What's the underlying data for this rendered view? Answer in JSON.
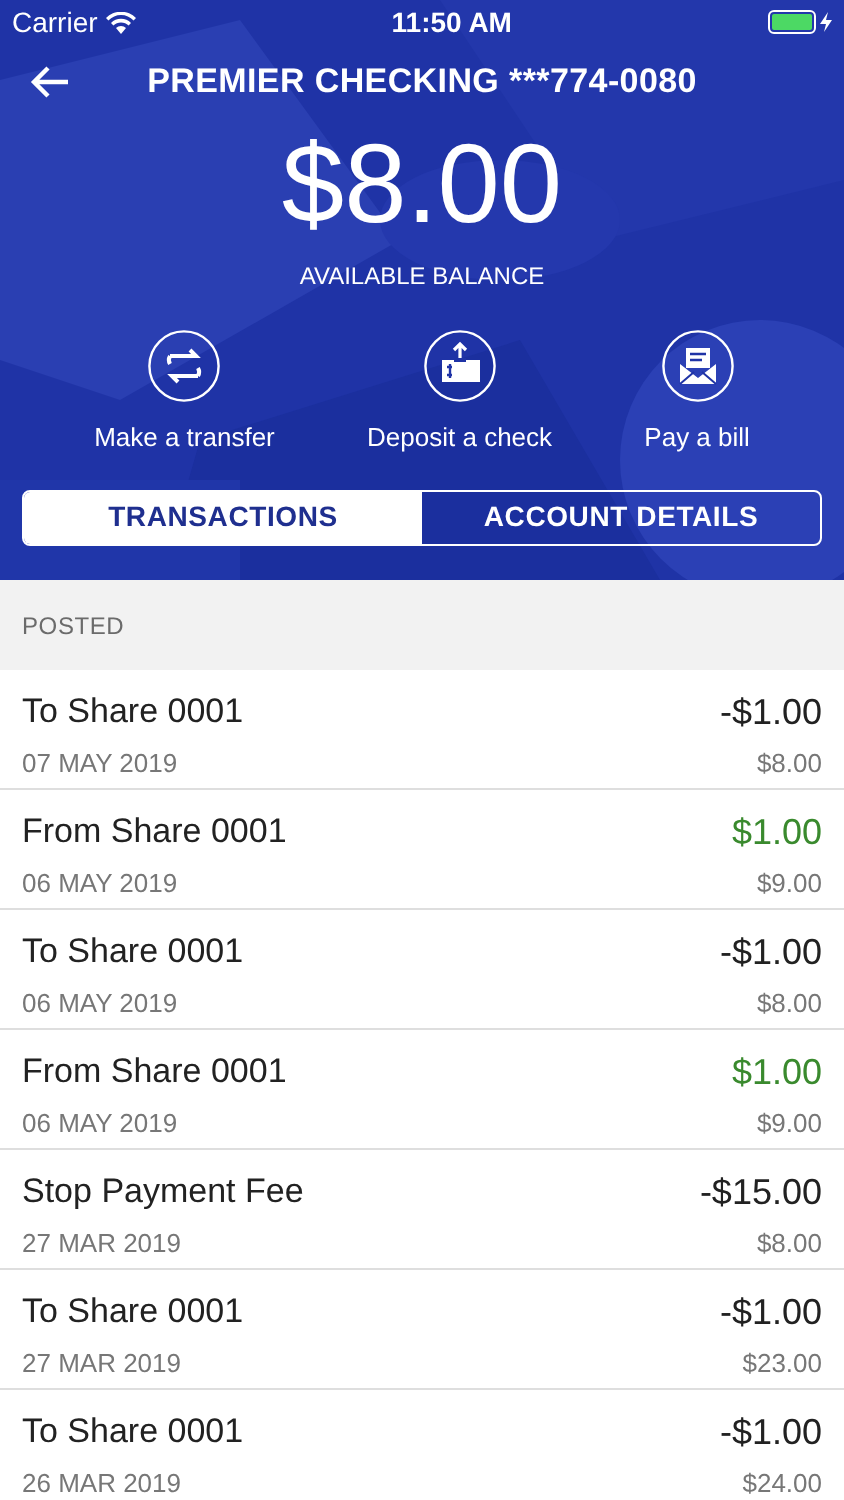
{
  "status_bar": {
    "carrier": "Carrier",
    "time": "11:50 AM"
  },
  "header": {
    "title": "PREMIER CHECKING ***774-0080",
    "balance": "$8.00",
    "balance_label": "AVAILABLE BALANCE"
  },
  "actions": [
    {
      "kind": "transfer",
      "label": "Make a transfer"
    },
    {
      "kind": "deposit",
      "label": "Deposit a check"
    },
    {
      "kind": "bill",
      "label": "Pay a bill"
    }
  ],
  "tabs": [
    {
      "label": "TRANSACTIONS",
      "selected": true
    },
    {
      "label": "ACCOUNT DETAILS",
      "selected": false
    }
  ],
  "section": "POSTED",
  "transactions": [
    {
      "description": "To Share 0001",
      "date": "07 MAY 2019",
      "amount": "-$1.00",
      "balance": "$8.00",
      "kind": "debit"
    },
    {
      "description": "From Share 0001",
      "date": "06 MAY 2019",
      "amount": "$1.00",
      "balance": "$9.00",
      "kind": "credit"
    },
    {
      "description": "To Share 0001",
      "date": "06 MAY 2019",
      "amount": "-$1.00",
      "balance": "$8.00",
      "kind": "debit"
    },
    {
      "description": "From Share 0001",
      "date": "06 MAY 2019",
      "amount": "$1.00",
      "balance": "$9.00",
      "kind": "credit"
    },
    {
      "description": "Stop Payment Fee",
      "date": "27 MAR 2019",
      "amount": "-$15.00",
      "balance": "$8.00",
      "kind": "debit"
    },
    {
      "description": "To Share 0001",
      "date": "27 MAR 2019",
      "amount": "-$1.00",
      "balance": "$23.00",
      "kind": "debit"
    },
    {
      "description": "To Share 0001",
      "date": "26 MAR 2019",
      "amount": "-$1.00",
      "balance": "$24.00",
      "kind": "debit"
    }
  ]
}
